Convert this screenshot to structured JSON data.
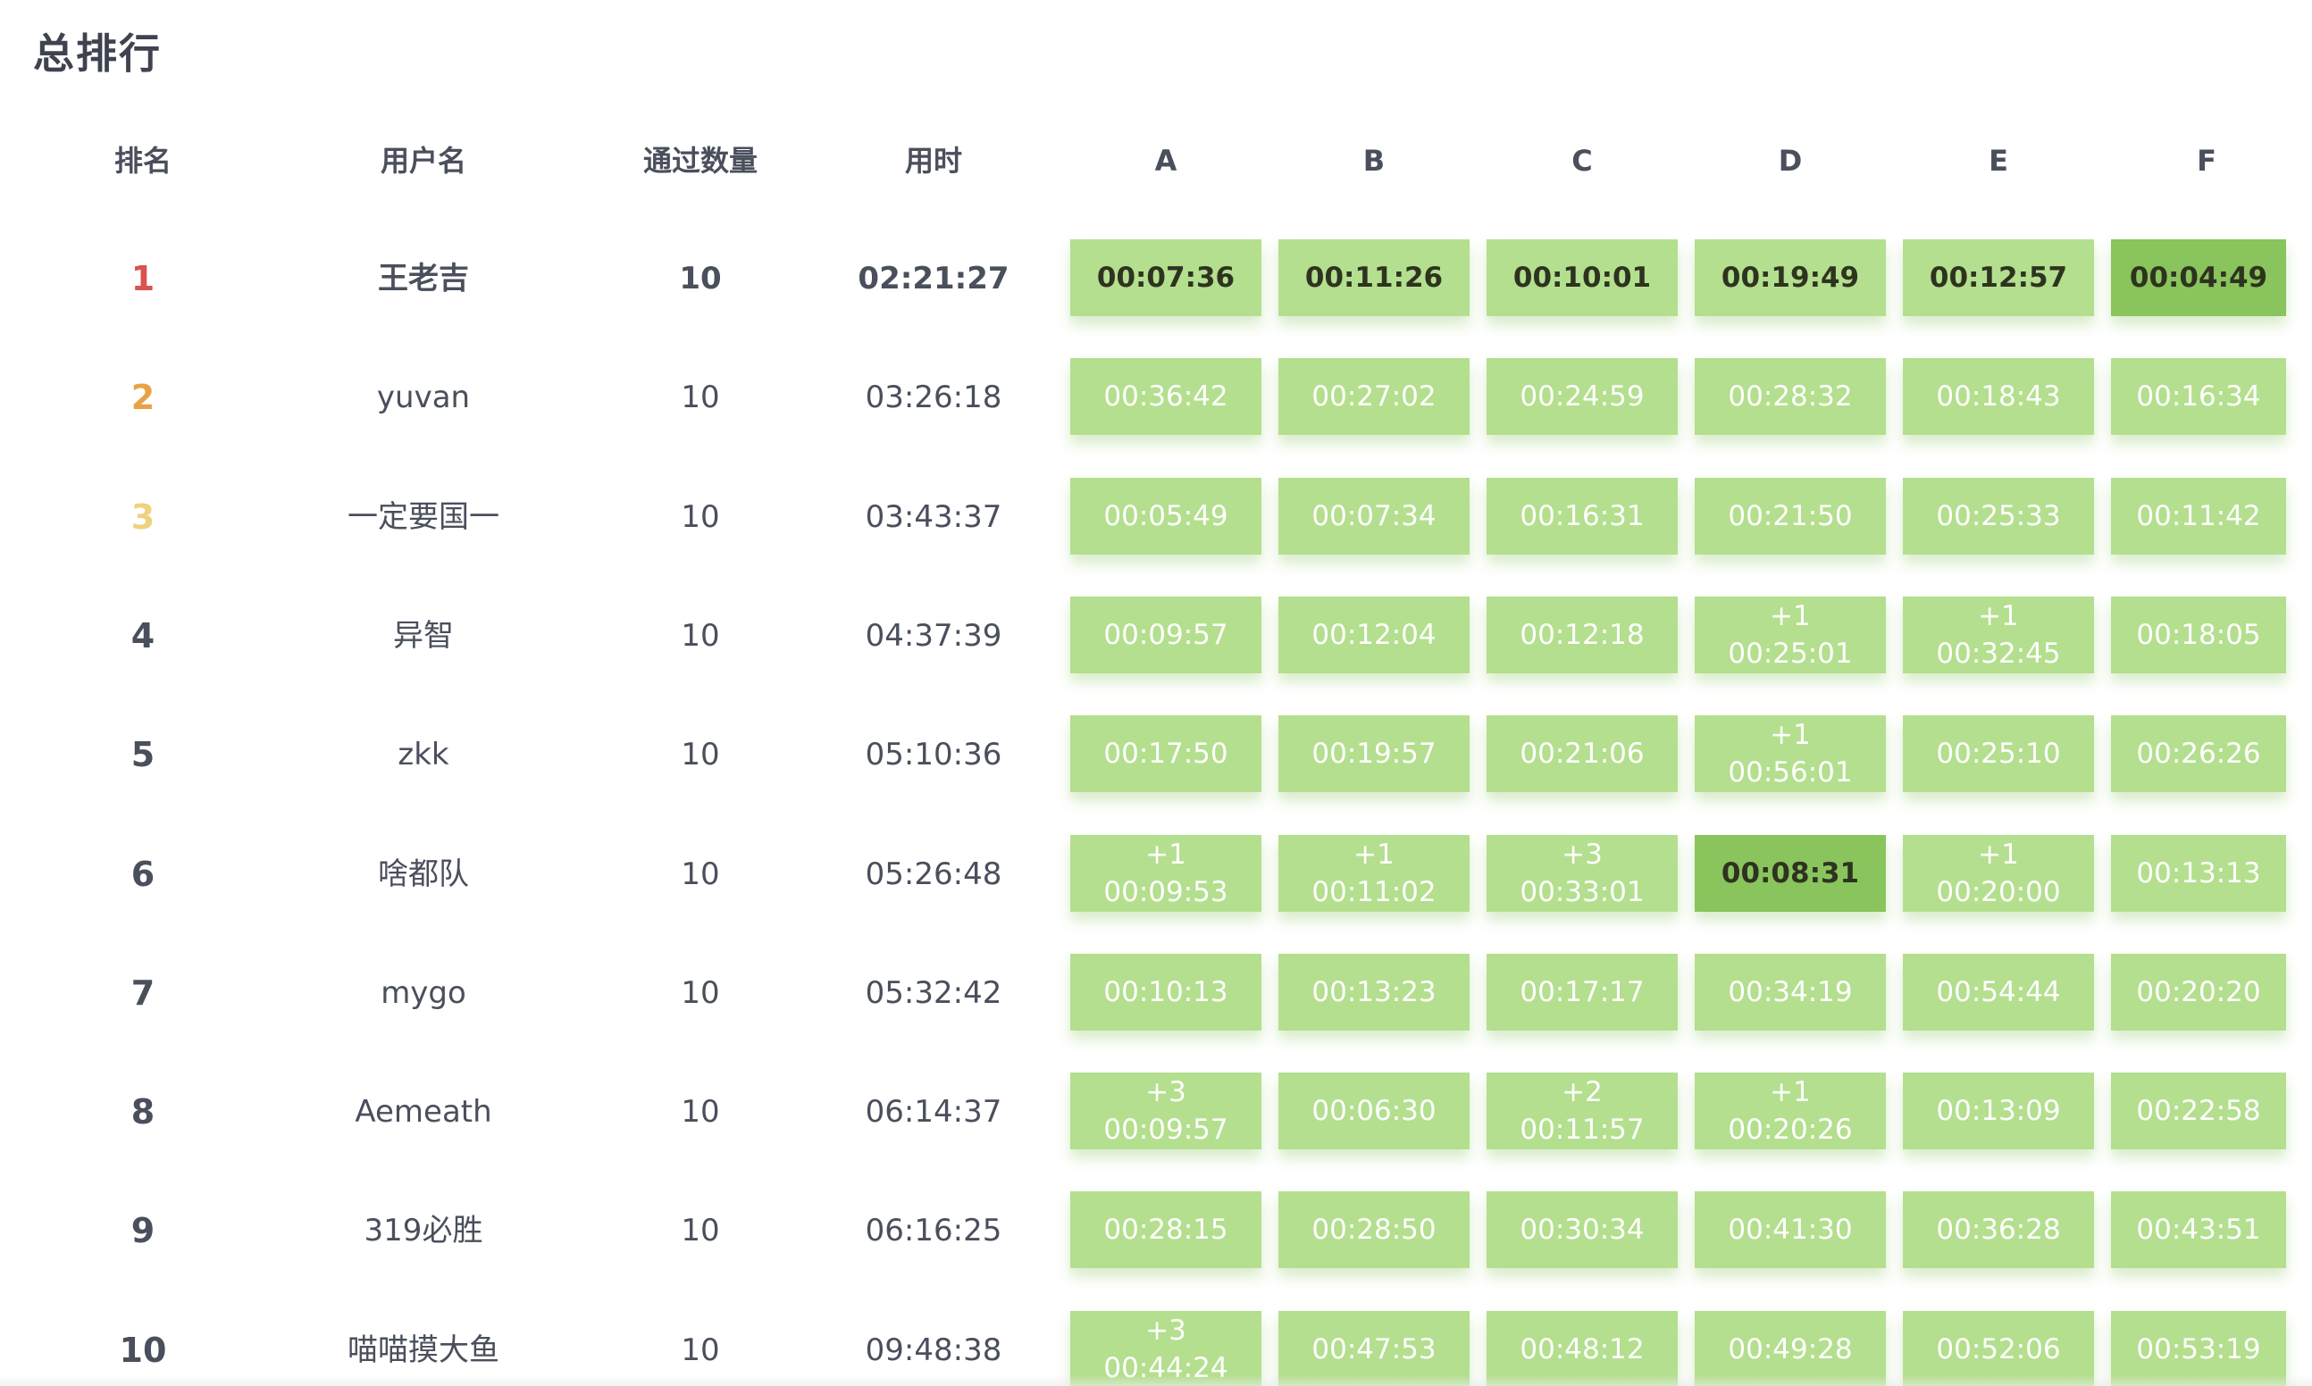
{
  "page_title": "总排行",
  "columns": {
    "rank": "排名",
    "username": "用户名",
    "solved": "通过数量",
    "time": "用时",
    "problems": [
      "A",
      "B",
      "C",
      "D",
      "E",
      "F"
    ]
  },
  "colors": {
    "ac": "#b4df8e",
    "first_blood": "#8ac45c",
    "rank1": "#d9534f",
    "rank2": "#e8a243",
    "rank3": "#efd27e"
  },
  "rows": [
    {
      "rank": "1",
      "user": "王老吉",
      "solved": "10",
      "time": "02:21:27",
      "cells": [
        {
          "pen": "",
          "time": "00:07:36",
          "fb": false
        },
        {
          "pen": "",
          "time": "00:11:26",
          "fb": false
        },
        {
          "pen": "",
          "time": "00:10:01",
          "fb": false
        },
        {
          "pen": "",
          "time": "00:19:49",
          "fb": false
        },
        {
          "pen": "",
          "time": "00:12:57",
          "fb": false
        },
        {
          "pen": "",
          "time": "00:04:49",
          "fb": true
        }
      ]
    },
    {
      "rank": "2",
      "user": "yuvan",
      "solved": "10",
      "time": "03:26:18",
      "cells": [
        {
          "pen": "",
          "time": "00:36:42",
          "fb": false
        },
        {
          "pen": "",
          "time": "00:27:02",
          "fb": false
        },
        {
          "pen": "",
          "time": "00:24:59",
          "fb": false
        },
        {
          "pen": "",
          "time": "00:28:32",
          "fb": false
        },
        {
          "pen": "",
          "time": "00:18:43",
          "fb": false
        },
        {
          "pen": "",
          "time": "00:16:34",
          "fb": false
        }
      ]
    },
    {
      "rank": "3",
      "user": "一定要国一",
      "solved": "10",
      "time": "03:43:37",
      "cells": [
        {
          "pen": "",
          "time": "00:05:49",
          "fb": false
        },
        {
          "pen": "",
          "time": "00:07:34",
          "fb": false
        },
        {
          "pen": "",
          "time": "00:16:31",
          "fb": false
        },
        {
          "pen": "",
          "time": "00:21:50",
          "fb": false
        },
        {
          "pen": "",
          "time": "00:25:33",
          "fb": false
        },
        {
          "pen": "",
          "time": "00:11:42",
          "fb": false
        }
      ]
    },
    {
      "rank": "4",
      "user": "异智",
      "solved": "10",
      "time": "04:37:39",
      "cells": [
        {
          "pen": "",
          "time": "00:09:57",
          "fb": false
        },
        {
          "pen": "",
          "time": "00:12:04",
          "fb": false
        },
        {
          "pen": "",
          "time": "00:12:18",
          "fb": false
        },
        {
          "pen": "+1",
          "time": "00:25:01",
          "fb": false
        },
        {
          "pen": "+1",
          "time": "00:32:45",
          "fb": false
        },
        {
          "pen": "",
          "time": "00:18:05",
          "fb": false
        }
      ]
    },
    {
      "rank": "5",
      "user": "zkk",
      "solved": "10",
      "time": "05:10:36",
      "cells": [
        {
          "pen": "",
          "time": "00:17:50",
          "fb": false
        },
        {
          "pen": "",
          "time": "00:19:57",
          "fb": false
        },
        {
          "pen": "",
          "time": "00:21:06",
          "fb": false
        },
        {
          "pen": "+1",
          "time": "00:56:01",
          "fb": false
        },
        {
          "pen": "",
          "time": "00:25:10",
          "fb": false
        },
        {
          "pen": "",
          "time": "00:26:26",
          "fb": false
        }
      ]
    },
    {
      "rank": "6",
      "user": "啥都队",
      "solved": "10",
      "time": "05:26:48",
      "cells": [
        {
          "pen": "+1",
          "time": "00:09:53",
          "fb": false
        },
        {
          "pen": "+1",
          "time": "00:11:02",
          "fb": false
        },
        {
          "pen": "+3",
          "time": "00:33:01",
          "fb": false
        },
        {
          "pen": "",
          "time": "00:08:31",
          "fb": true
        },
        {
          "pen": "+1",
          "time": "00:20:00",
          "fb": false
        },
        {
          "pen": "",
          "time": "00:13:13",
          "fb": false
        }
      ]
    },
    {
      "rank": "7",
      "user": "mygo",
      "solved": "10",
      "time": "05:32:42",
      "cells": [
        {
          "pen": "",
          "time": "00:10:13",
          "fb": false
        },
        {
          "pen": "",
          "time": "00:13:23",
          "fb": false
        },
        {
          "pen": "",
          "time": "00:17:17",
          "fb": false
        },
        {
          "pen": "",
          "time": "00:34:19",
          "fb": false
        },
        {
          "pen": "",
          "time": "00:54:44",
          "fb": false
        },
        {
          "pen": "",
          "time": "00:20:20",
          "fb": false
        }
      ]
    },
    {
      "rank": "8",
      "user": "Aemeath",
      "solved": "10",
      "time": "06:14:37",
      "cells": [
        {
          "pen": "+3",
          "time": "00:09:57",
          "fb": false
        },
        {
          "pen": "",
          "time": "00:06:30",
          "fb": false
        },
        {
          "pen": "+2",
          "time": "00:11:57",
          "fb": false
        },
        {
          "pen": "+1",
          "time": "00:20:26",
          "fb": false
        },
        {
          "pen": "",
          "time": "00:13:09",
          "fb": false
        },
        {
          "pen": "",
          "time": "00:22:58",
          "fb": false
        }
      ]
    },
    {
      "rank": "9",
      "user": "319必胜",
      "solved": "10",
      "time": "06:16:25",
      "cells": [
        {
          "pen": "",
          "time": "00:28:15",
          "fb": false
        },
        {
          "pen": "",
          "time": "00:28:50",
          "fb": false
        },
        {
          "pen": "",
          "time": "00:30:34",
          "fb": false
        },
        {
          "pen": "",
          "time": "00:41:30",
          "fb": false
        },
        {
          "pen": "",
          "time": "00:36:28",
          "fb": false
        },
        {
          "pen": "",
          "time": "00:43:51",
          "fb": false
        }
      ]
    },
    {
      "rank": "10",
      "user": "喵喵摸大鱼",
      "solved": "10",
      "time": "09:48:38",
      "cells": [
        {
          "pen": "+3",
          "time": "00:44:24",
          "fb": false
        },
        {
          "pen": "",
          "time": "00:47:53",
          "fb": false
        },
        {
          "pen": "",
          "time": "00:48:12",
          "fb": false
        },
        {
          "pen": "",
          "time": "00:49:28",
          "fb": false
        },
        {
          "pen": "",
          "time": "00:52:06",
          "fb": false
        },
        {
          "pen": "",
          "time": "00:53:19",
          "fb": false
        }
      ]
    }
  ]
}
